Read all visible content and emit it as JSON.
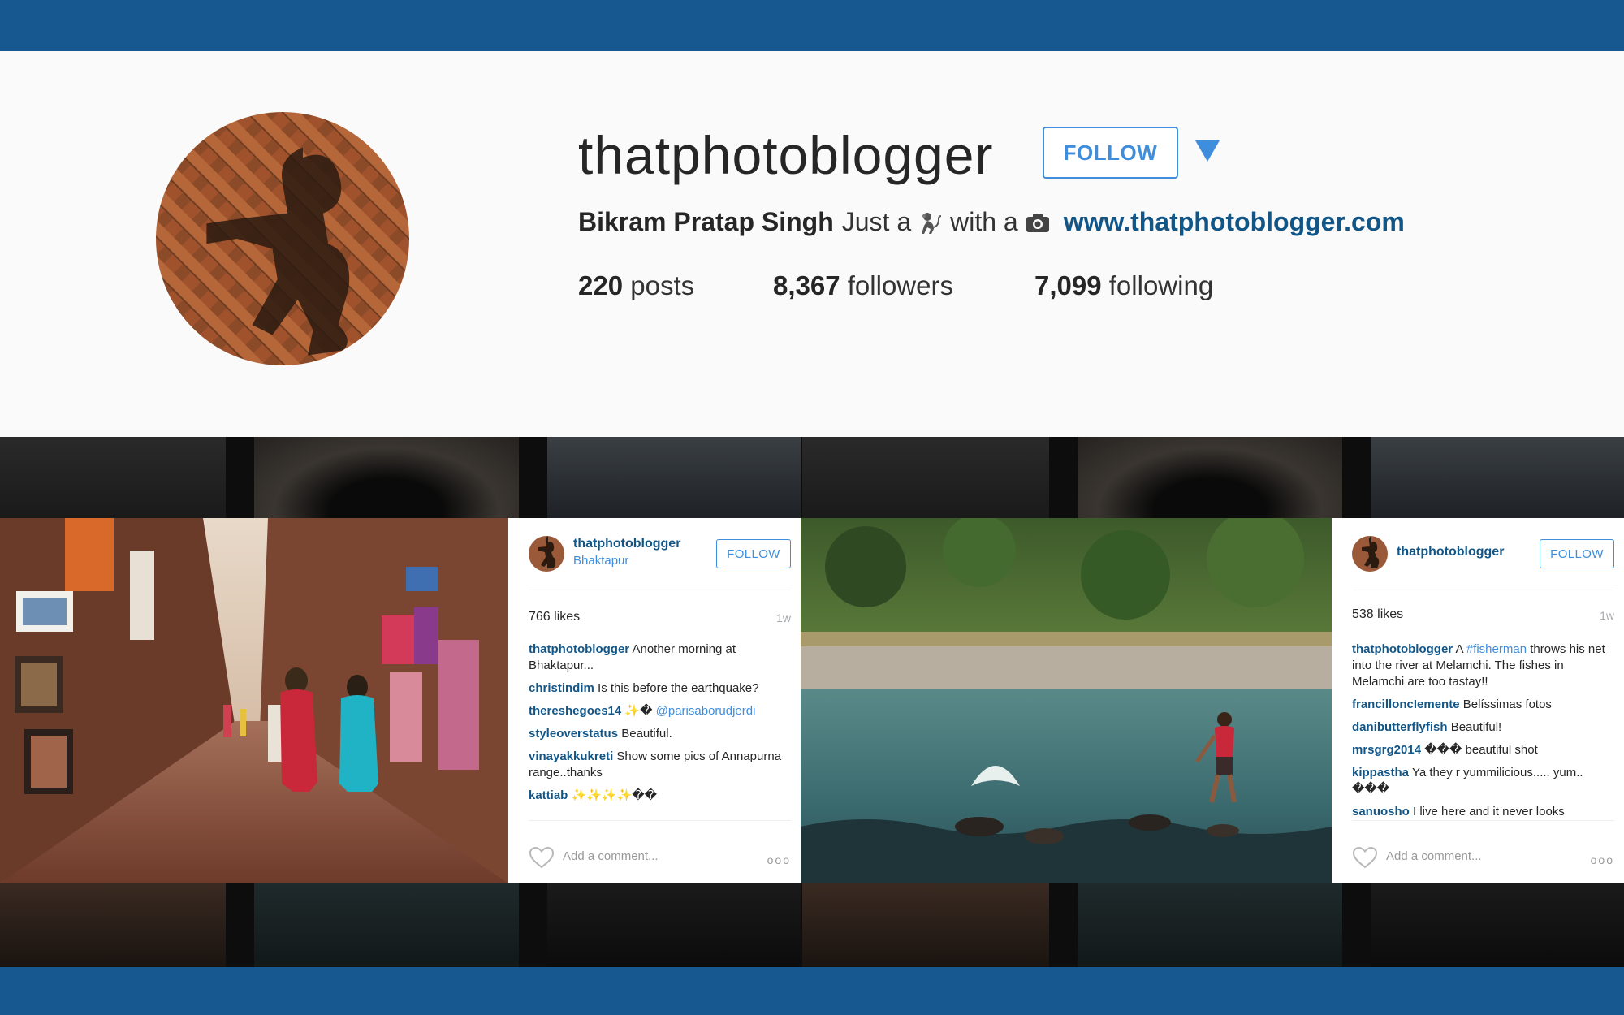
{
  "profile": {
    "username": "thatphotoblogger",
    "follow_label": "FOLLOW",
    "full_name": "Bikram Pratap Singh",
    "bio_part1": "Just a",
    "bio_part2": "with a",
    "website": "www.thatphotoblogger.com",
    "posts_count": "220",
    "posts_label": "posts",
    "followers_count": "8,367",
    "followers_label": "followers",
    "following_count": "7,099",
    "following_label": "following"
  },
  "posts": [
    {
      "username": "thatphotoblogger",
      "location": "Bhaktapur",
      "follow_label": "FOLLOW",
      "likes": "766 likes",
      "ago": "1w",
      "comments": [
        {
          "user": "thatphotoblogger",
          "text": "Another morning at Bhaktapur..."
        },
        {
          "user": "christindim",
          "text": "Is this before the earthquake?"
        },
        {
          "user": "thereshegoes14",
          "text": "✨�",
          "tag": "@parisaborudjerdi"
        },
        {
          "user": "styleoverstatus",
          "text": "Beautiful."
        },
        {
          "user": "vinayakkukreti",
          "text": "Show some pics of Annapurna range..thanks"
        },
        {
          "user": "kattiab",
          "text": "✨✨✨✨��"
        }
      ],
      "add_comment_placeholder": "Add a comment...",
      "more": "ooo"
    },
    {
      "username": "thatphotoblogger",
      "follow_label": "FOLLOW",
      "likes": "538 likes",
      "ago": "1w",
      "comments": [
        {
          "user": "thatphotoblogger",
          "text_before": "A",
          "tag": "#fisherman",
          "text": "throws his net into the river at Melamchi. The fishes in Melamchi are too tastay!!"
        },
        {
          "user": "francilloncIemente",
          "text": "Belíssimas fotos"
        },
        {
          "user": "danibutterflyfish",
          "text": "Beautiful!"
        },
        {
          "user": "mrsgrg2014",
          "text": "��� beautiful shot"
        },
        {
          "user": "kippastha",
          "text": "Ya they r yummilicious..... yum.. ���"
        },
        {
          "user": "sanuosho",
          "text": "I live here and it never looks"
        }
      ],
      "add_comment_placeholder": "Add a comment...",
      "more": "ooo"
    }
  ],
  "colors": {
    "band": "#16588f",
    "accent": "#3f8edd",
    "link": "#125688"
  },
  "icons": [
    "dropdown-caret-icon",
    "monkey-icon",
    "camera-icon",
    "heart-icon",
    "more-options-icon"
  ]
}
